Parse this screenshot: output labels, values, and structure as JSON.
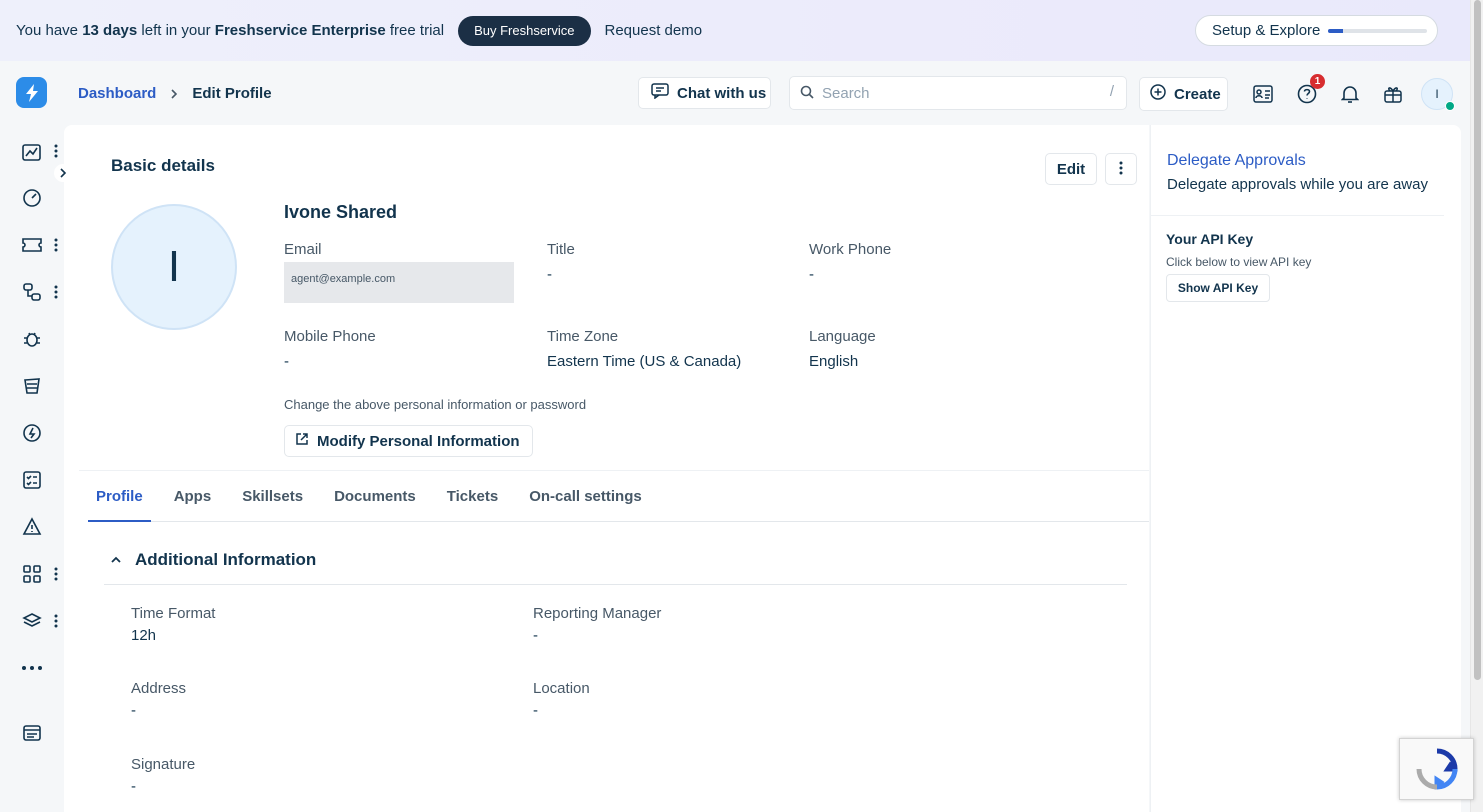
{
  "banner": {
    "text_prefix": "You have ",
    "days": "13 days",
    "text_mid": " left in your ",
    "product": "Freshservice Enterprise",
    "text_suffix": " free trial",
    "buy_label": "Buy Freshservice",
    "demo_label": "Request demo",
    "setup_label": "Setup & Explore",
    "setup_progress": 0.15
  },
  "nav": {
    "items": [
      {
        "icon": "analytics-icon",
        "has_menu": true
      },
      {
        "icon": "dashboard-gauge-icon",
        "has_menu": false
      },
      {
        "icon": "tickets-icon",
        "has_menu": true
      },
      {
        "icon": "changes-icon",
        "has_menu": true
      },
      {
        "icon": "problems-bug-icon",
        "has_menu": false
      },
      {
        "icon": "releases-icon",
        "has_menu": false
      },
      {
        "icon": "assets-icon",
        "has_menu": false
      },
      {
        "icon": "tasks-checklist-icon",
        "has_menu": false
      },
      {
        "icon": "alerts-icon",
        "has_menu": false
      },
      {
        "icon": "apps-grid-icon",
        "has_menu": true
      },
      {
        "icon": "layers-icon",
        "has_menu": true
      },
      {
        "icon": "more-horizontal-icon",
        "has_menu": false
      },
      {
        "icon": "admin-icon",
        "has_menu": false
      }
    ]
  },
  "header": {
    "breadcrumb_root": "Dashboard",
    "breadcrumb_current": "Edit Profile",
    "chat_label": "Chat with us",
    "search_placeholder": "Search",
    "search_shortcut": "/",
    "create_label": "Create",
    "help_badge": "1",
    "avatar_initial": "I"
  },
  "profile": {
    "section_title": "Basic details",
    "edit_label": "Edit",
    "avatar_initial": "I",
    "name": "Ivone Shared",
    "email_label": "Email",
    "email_value": "agent@example.com",
    "title_label": "Title",
    "title_value": "-",
    "work_phone_label": "Work Phone",
    "work_phone_value": "-",
    "mobile_label": "Mobile Phone",
    "mobile_value": "-",
    "timezone_label": "Time Zone",
    "timezone_value": "Eastern Time (US & Canada)",
    "language_label": "Language",
    "language_value": "English",
    "change_note": "Change the above personal information or password",
    "modify_label": "Modify Personal Information"
  },
  "tabs": [
    {
      "label": "Profile",
      "active": true
    },
    {
      "label": "Apps",
      "active": false
    },
    {
      "label": "Skillsets",
      "active": false
    },
    {
      "label": "Documents",
      "active": false
    },
    {
      "label": "Tickets",
      "active": false
    },
    {
      "label": "On-call settings",
      "active": false
    }
  ],
  "additional": {
    "title": "Additional Information",
    "time_format_label": "Time Format",
    "time_format_value": "12h",
    "reporting_label": "Reporting Manager",
    "reporting_value": "-",
    "address_label": "Address",
    "address_value": "-",
    "location_label": "Location",
    "location_value": "-",
    "signature_label": "Signature",
    "signature_value": "-"
  },
  "right_panel": {
    "delegate_title": "Delegate Approvals",
    "delegate_desc": "Delegate approvals while you are away",
    "api_title": "Your API Key",
    "api_desc": "Click below to view API key",
    "api_button": "Show API Key"
  },
  "colors": {
    "accent": "#2c5cc5",
    "text": "#12344d",
    "logo": "#2c8ce8",
    "badge": "#d72d30",
    "presence": "#00a886"
  }
}
